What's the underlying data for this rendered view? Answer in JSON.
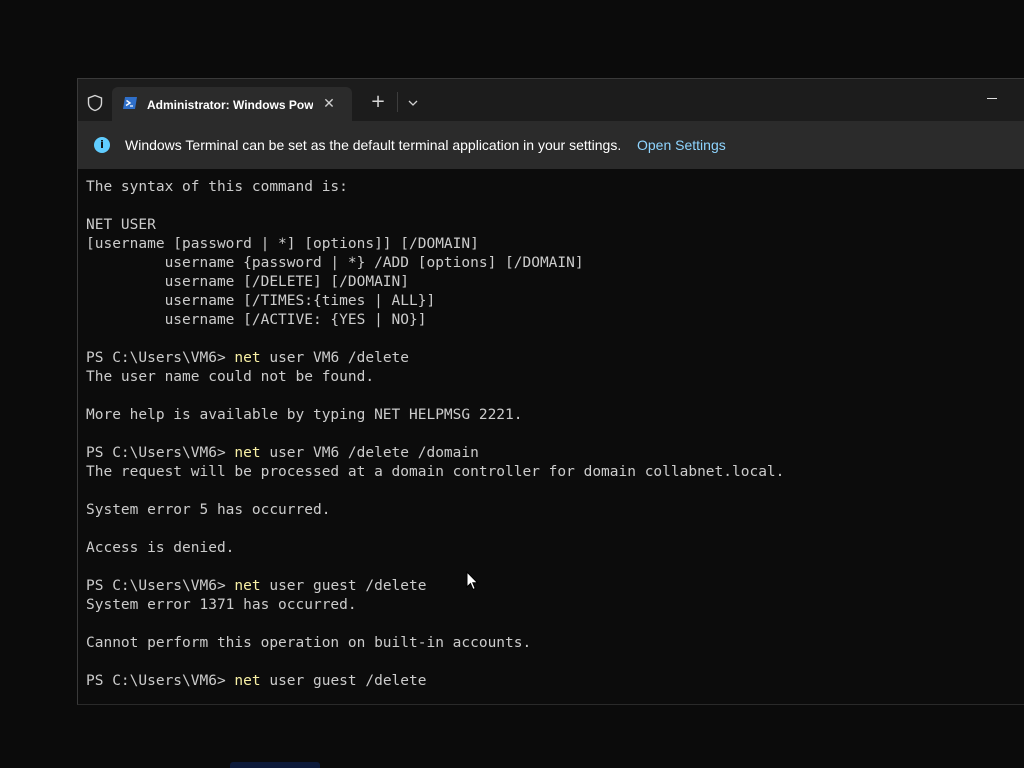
{
  "window": {
    "tab_title": "Administrator: Windows PowerShell",
    "tab_close_icon": "close-icon",
    "new_tab_label": "+",
    "dropdown_icon": "chevron-down-icon",
    "minimize_icon": "minimize-icon"
  },
  "infobar": {
    "icon": "info-icon",
    "icon_glyph": "i",
    "message": "Windows Terminal can be set as the default terminal application in your settings.",
    "link": "Open Settings",
    "accent": "#60cdff"
  },
  "console": {
    "prompt": "PS C:\\Users\\VM6>",
    "lines": [
      {
        "text": "The syntax of this command is:"
      },
      {
        "text": ""
      },
      {
        "text": "NET USER"
      },
      {
        "text": "[username [password | *] [options]] [/DOMAIN]"
      },
      {
        "text": "         username {password | *} /ADD [options] [/DOMAIN]"
      },
      {
        "text": "         username [/DELETE] [/DOMAIN]"
      },
      {
        "text": "         username [/TIMES:{times | ALL}]"
      },
      {
        "text": "         username [/ACTIVE: {YES | NO}]"
      },
      {
        "text": ""
      },
      {
        "prompt": "PS C:\\Users\\VM6> ",
        "cmd": "net",
        "args": " user VM6 /delete"
      },
      {
        "text": "The user name could not be found."
      },
      {
        "text": ""
      },
      {
        "text": "More help is available by typing NET HELPMSG 2221."
      },
      {
        "text": ""
      },
      {
        "prompt": "PS C:\\Users\\VM6> ",
        "cmd": "net",
        "args": " user VM6 /delete /domain"
      },
      {
        "text": "The request will be processed at a domain controller for domain collabnet.local."
      },
      {
        "text": ""
      },
      {
        "text": "System error 5 has occurred."
      },
      {
        "text": ""
      },
      {
        "text": "Access is denied."
      },
      {
        "text": ""
      },
      {
        "prompt": "PS C:\\Users\\VM6> ",
        "cmd": "net",
        "args": " user guest /delete"
      },
      {
        "text": "System error 1371 has occurred."
      },
      {
        "text": ""
      },
      {
        "text": "Cannot perform this operation on built-in accounts."
      },
      {
        "text": ""
      },
      {
        "prompt": "PS C:\\Users\\VM6> ",
        "cmd": "net",
        "args": " user guest /delete"
      }
    ],
    "colors": {
      "text": "#cccccc",
      "command": "#f9f1a5",
      "background": "#0c0c0c"
    }
  }
}
